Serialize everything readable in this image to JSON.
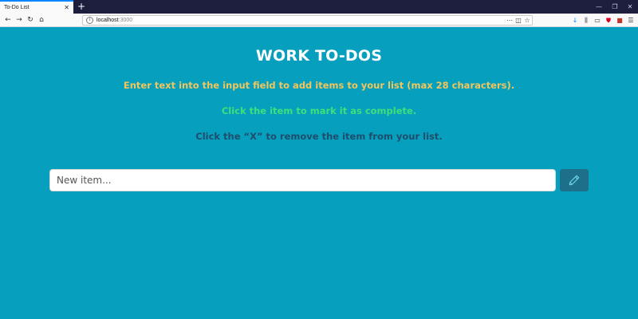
{
  "browser": {
    "tab_title": "To-Do List",
    "tab_close": "✕",
    "new_tab": "+",
    "url_host": "localhost",
    "url_port": ":3000",
    "window_controls": [
      "—",
      "❐",
      "✕"
    ]
  },
  "page": {
    "heading": "WORK TO-DOS",
    "instructions": [
      "Enter text into the input field to add items to your list (max 28 characters).",
      "Click the item to mark it as complete.",
      "Click the “X” to remove the item from your list."
    ],
    "input": {
      "placeholder": "New item...",
      "value": ""
    },
    "add_button_icon": "pencil-icon"
  },
  "colors": {
    "background": "#069fbe",
    "heading": "#ffffff",
    "instruction_1": "#f2c65a",
    "instruction_2": "#3fe07a",
    "instruction_3": "#1f4d6b",
    "button": "#1e6f8a"
  }
}
